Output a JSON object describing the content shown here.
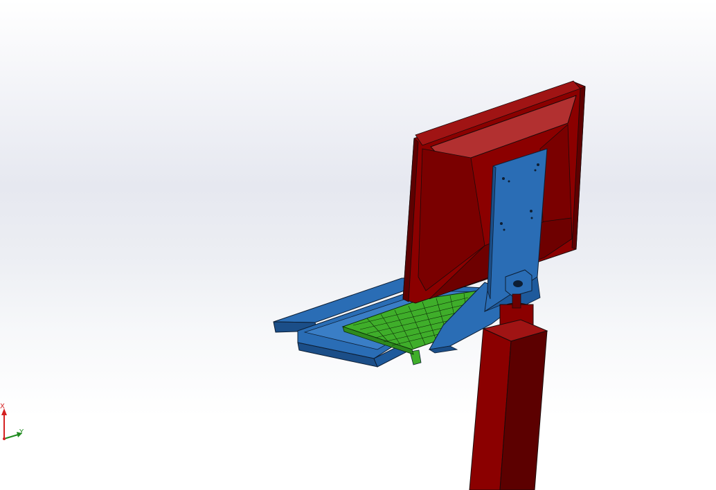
{
  "viewport": {
    "background_top": "#ffffff",
    "background_band": "#e6e8f0"
  },
  "model": {
    "colors": {
      "monitor": "#8b0000",
      "monitor_highlight": "#b23030",
      "monitor_shadow": "#5e0000",
      "bracket": "#2a6db5",
      "bracket_shadow": "#1b4e88",
      "keyboard": "#3fae2a",
      "keyboard_keys": "#6fd356",
      "pole": "#8b0000",
      "pole_shadow": "#5c0000",
      "edge": "#1a0a0a"
    },
    "parts": [
      "monitor",
      "mounting-bracket",
      "keyboard-tray",
      "keyboard",
      "support-pole"
    ]
  },
  "triad": {
    "x_label": "X",
    "y_label": "Y",
    "x_color": "#d42020",
    "y_color": "#1e8a1e"
  }
}
